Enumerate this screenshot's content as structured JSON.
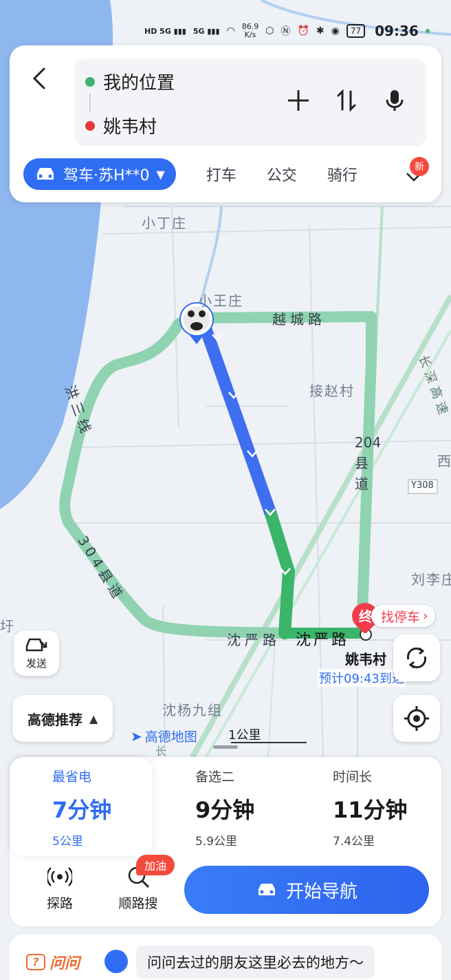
{
  "status_bar": {
    "net_speed": "86.9\nK/s",
    "battery": "77",
    "time": "09:36"
  },
  "search": {
    "origin": "我的位置",
    "destination": "姚韦村"
  },
  "modes": {
    "active": "驾车·苏H**0",
    "taxi": "打车",
    "bus": "公交",
    "bike": "骑行",
    "new_badge": "新"
  },
  "map": {
    "labels": {
      "xiaodingzhuang": "小丁庄",
      "xiaowangzhuang": "小王庄",
      "jiezhaocun": "接赵村",
      "liulizhuang": "刘李庄",
      "shenyang9": "沈杨九组",
      "xi": "西",
      "hu": "圩"
    },
    "roads": {
      "yuecheng": "越城路",
      "hongsan": "洪三线",
      "changshen": "长深高速",
      "county204": "204县道",
      "county304": "304县道",
      "shenyan_left": "沈严路",
      "shenyan_right": "沈严路",
      "y308": "Y308",
      "chang": "长"
    },
    "park_tag": "找停车",
    "end_marker": "终",
    "dest_name": "姚韦村",
    "eta": "预计09:43到达",
    "share_label": "发送",
    "recommend": "高德推荐",
    "amap_logo": "高德地图",
    "scale": "1公里"
  },
  "routes": [
    {
      "tag": "最省电",
      "duration": "7分钟",
      "distance": "5公里"
    },
    {
      "tag": "备选二",
      "duration": "9分钟",
      "distance": "5.9公里"
    },
    {
      "tag": "时间长",
      "duration": "11分钟",
      "distance": "7.4公里"
    }
  ],
  "tools": {
    "explore": "探路",
    "along_search": "顺路搜",
    "gas_badge": "加油",
    "start_nav": "开始导航"
  },
  "ask": {
    "logo": "问问",
    "prompt": "问问去过的朋友这里必去的地方～"
  },
  "colors": {
    "accent": "#2f6df2",
    "route_main": "#3f6ef0",
    "route_green": "#3ab56a",
    "route_alt": "#8fd3b0",
    "water": "#8fb7ef",
    "end_pin": "#f23d4f"
  }
}
